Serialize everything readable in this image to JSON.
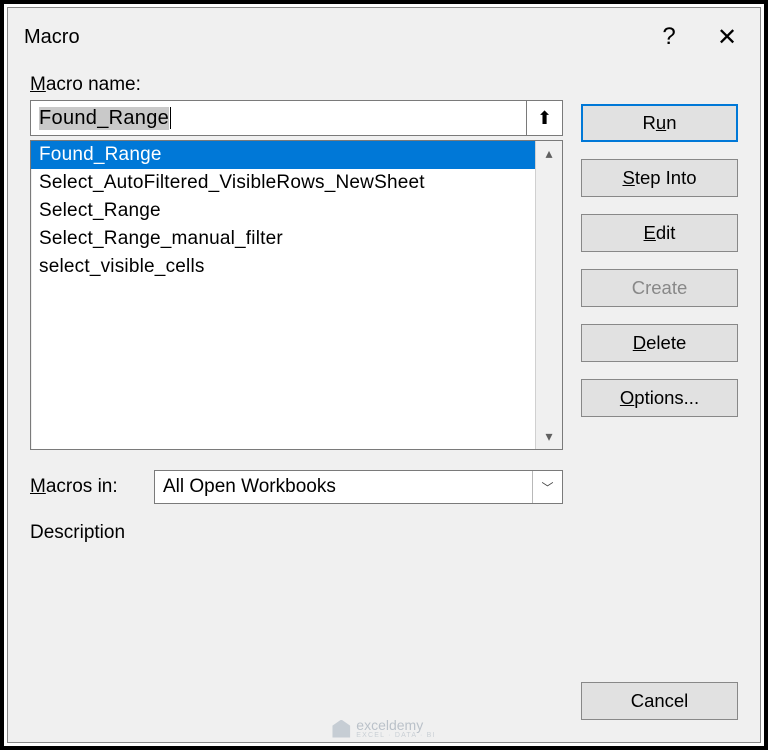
{
  "titlebar": {
    "title": "Macro",
    "help": "?",
    "close": "✕"
  },
  "labels": {
    "macro_name": "acro name:",
    "macro_name_prefix": "M",
    "macros_in": "acros in:",
    "macros_in_prefix": "M",
    "description": "Description"
  },
  "name_input": {
    "value": "Found_Range"
  },
  "ref_icon": "⬆",
  "macro_list": [
    "Found_Range",
    "Select_AutoFiltered_VisibleRows_NewSheet",
    "Select_Range",
    "Select_Range_manual_filter",
    "select_visible_cells"
  ],
  "selected_index": 0,
  "dropdown": {
    "value": "All Open Workbooks"
  },
  "buttons": {
    "run_pre": "R",
    "run_u": "u",
    "run_post": "n",
    "step_pre": "",
    "step_u": "S",
    "step_post": "tep Into",
    "edit_pre": "",
    "edit_u": "E",
    "edit_post": "dit",
    "create_pre": "",
    "create_u": "C",
    "create_post": "reate",
    "delete_pre": "",
    "delete_u": "D",
    "delete_post": "elete",
    "options_pre": "",
    "options_u": "O",
    "options_post": "ptions...",
    "cancel": "Cancel"
  },
  "scroll": {
    "up": "▴",
    "down": "▾"
  },
  "watermark": {
    "name": "exceldemy",
    "sub": "EXCEL · DATA · BI"
  }
}
